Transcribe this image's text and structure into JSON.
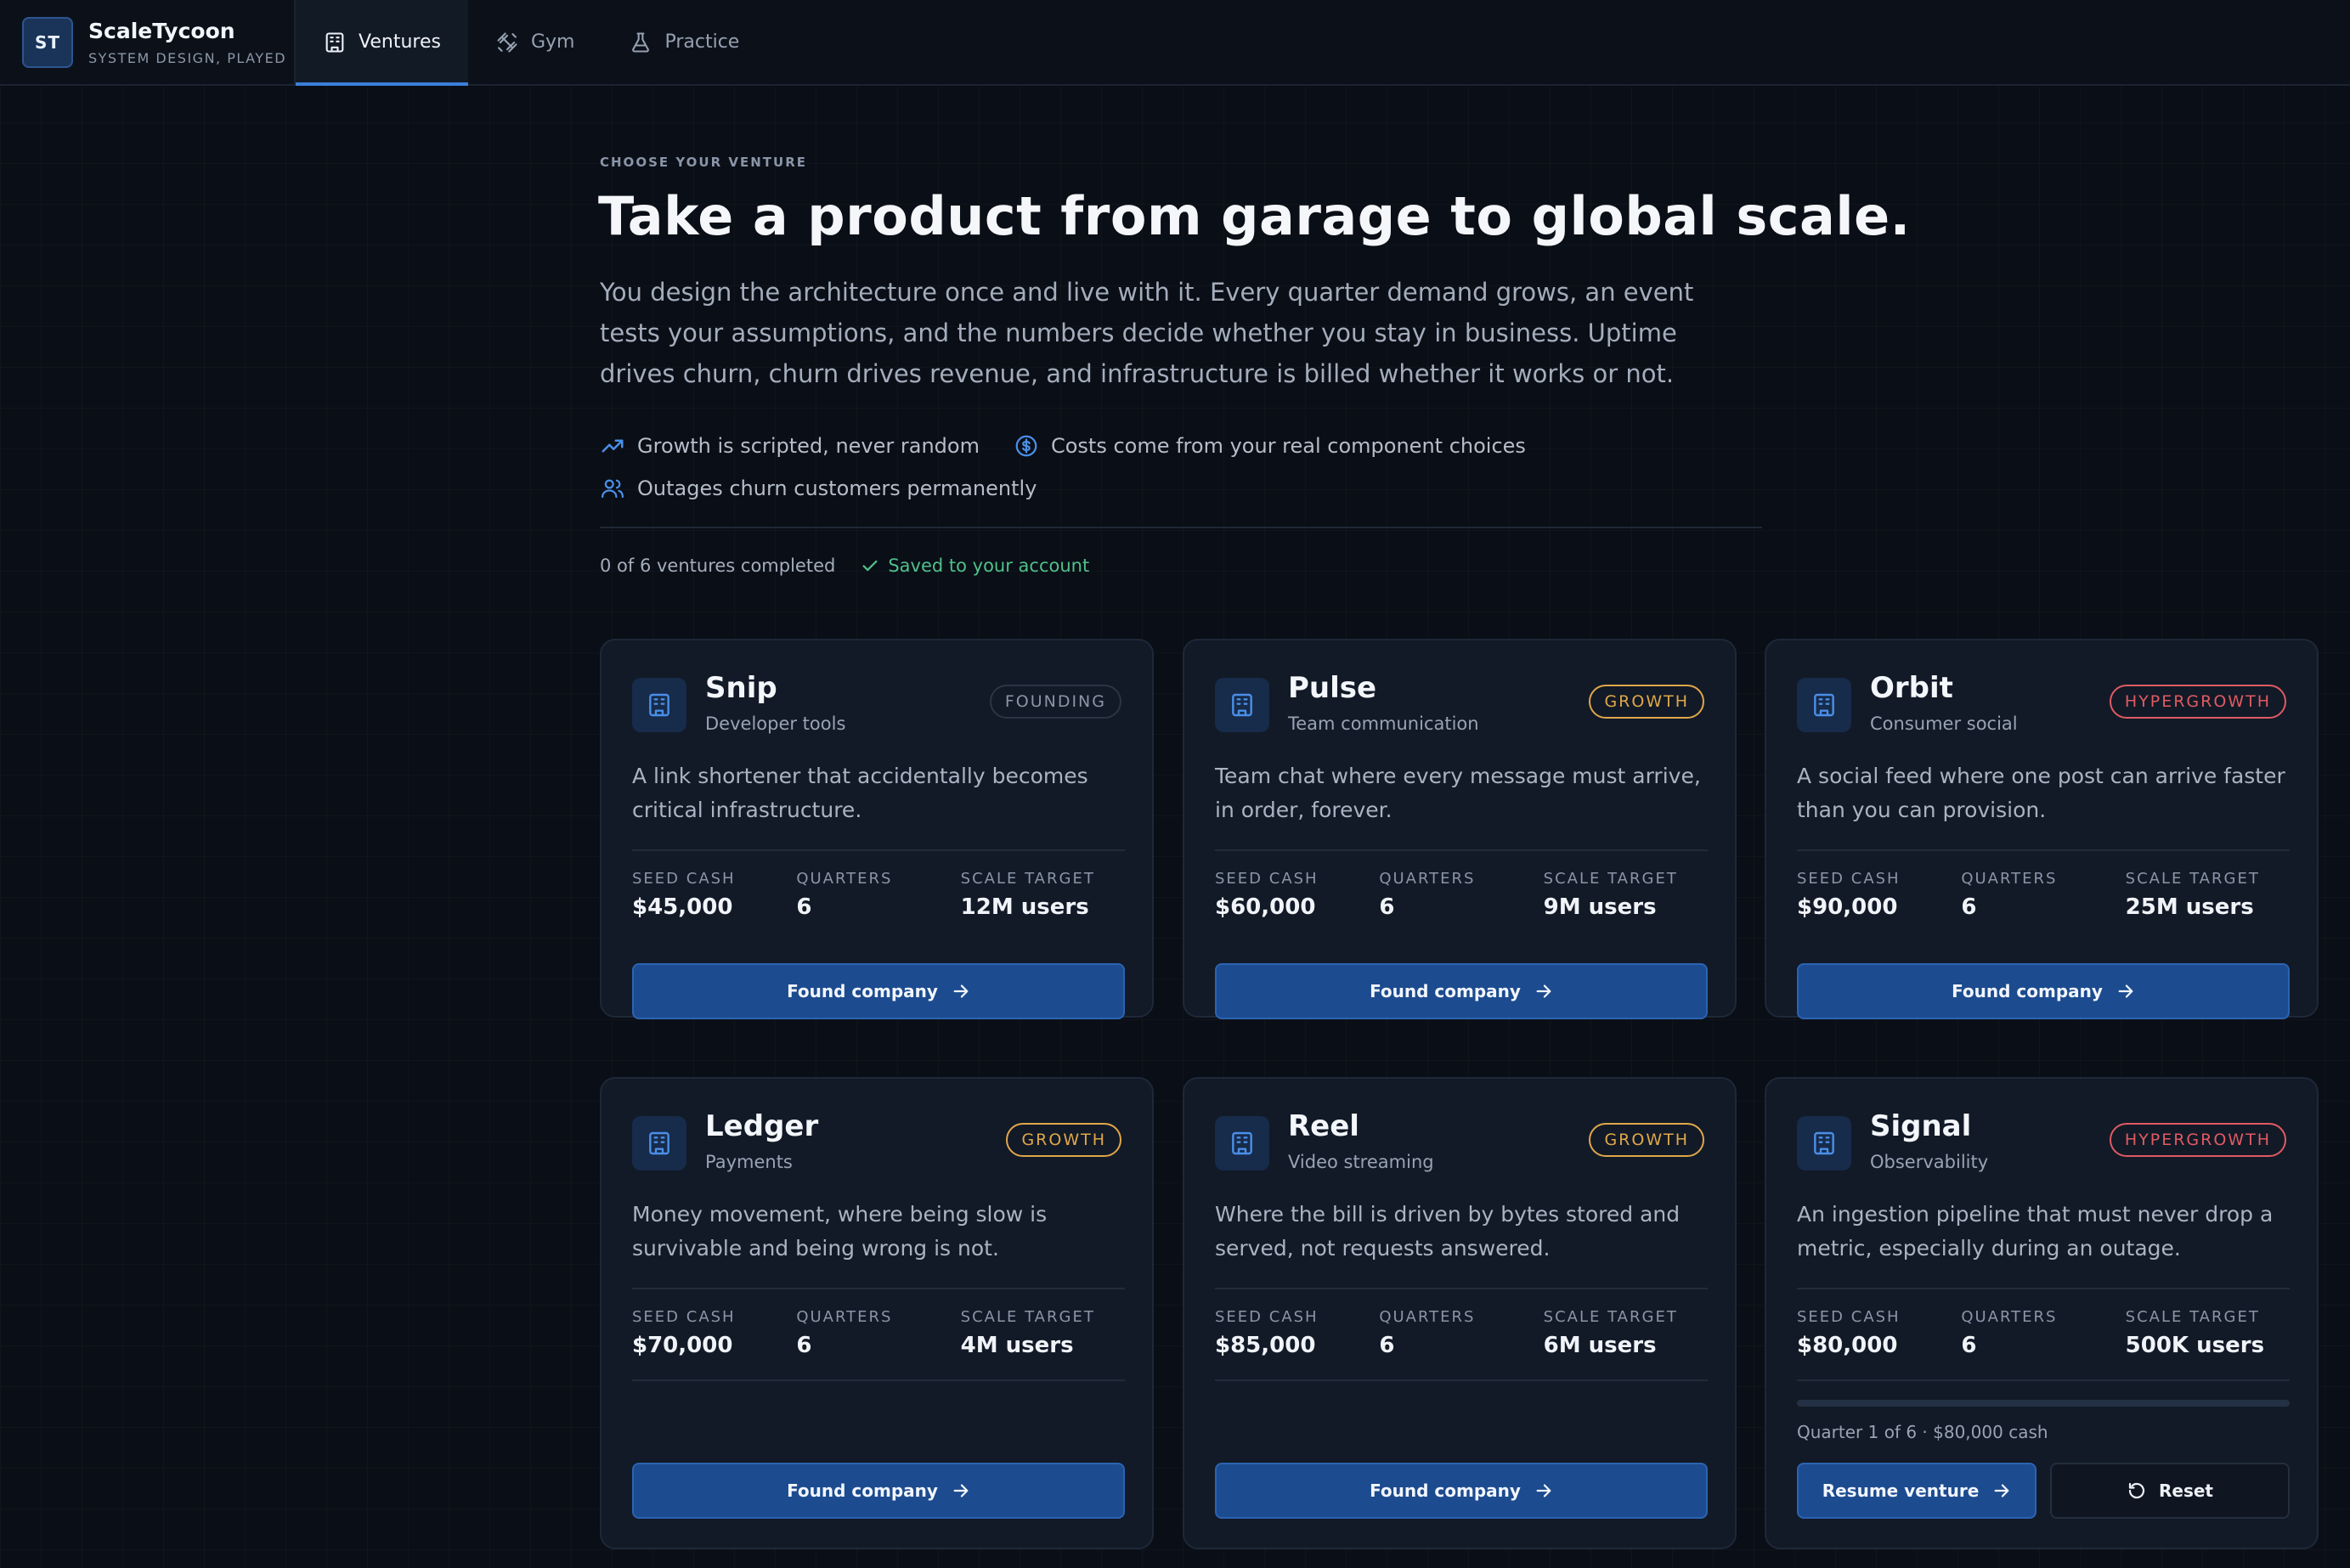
{
  "brand": {
    "logo": "ST",
    "name": "ScaleTycoon",
    "tagline": "SYSTEM DESIGN, PLAYED"
  },
  "nav": {
    "tabs": [
      {
        "label": "Ventures",
        "icon": "building-icon",
        "active": true
      },
      {
        "label": "Gym",
        "icon": "dumbbell-icon",
        "active": false
      },
      {
        "label": "Practice",
        "icon": "flask-icon",
        "active": false
      }
    ]
  },
  "hero": {
    "eyebrow": "CHOOSE YOUR VENTURE",
    "headline": "Take a product from garage to global scale.",
    "intro": "You design the architecture once and live with it. Every quarter demand grows, an event tests your assumptions, and the numbers decide whether you stay in business. Uptime drives churn, churn drives revenue, and infrastructure is billed whether it works or not.",
    "features": [
      {
        "icon": "trending-up-icon",
        "text": "Growth is scripted, never random"
      },
      {
        "icon": "dollar-circle-icon",
        "text": "Costs come from your real component choices"
      },
      {
        "icon": "users-icon",
        "text": "Outages churn customers permanently"
      }
    ]
  },
  "progress": {
    "count": "0 of 6 ventures completed",
    "saved": "Saved to your account"
  },
  "stat_labels": {
    "cash": "SEED CASH",
    "quarters": "QUARTERS",
    "target": "SCALE TARGET"
  },
  "colors": {
    "founding": "#8b95a6",
    "growth": "#e0a74a",
    "hypergrowth": "#e05a63",
    "accent": "#3b7fd9"
  },
  "ventures": [
    {
      "name": "Snip",
      "category": "Developer tools",
      "stage": "FOUNDING",
      "description": "A link shortener that accidentally becomes critical infrastructure.",
      "seed_cash": "$45,000",
      "quarters": "6",
      "scale_target": "12M users",
      "action": "Found company"
    },
    {
      "name": "Pulse",
      "category": "Team communication",
      "stage": "GROWTH",
      "description": "Team chat where every message must arrive, in order, forever.",
      "seed_cash": "$60,000",
      "quarters": "6",
      "scale_target": "9M users",
      "action": "Found company"
    },
    {
      "name": "Orbit",
      "category": "Consumer social",
      "stage": "HYPERGROWTH",
      "description": "A social feed where one post can arrive faster than you can provision.",
      "seed_cash": "$90,000",
      "quarters": "6",
      "scale_target": "25M users",
      "action": "Found company"
    },
    {
      "name": "Ledger",
      "category": "Payments",
      "stage": "GROWTH",
      "description": "Money movement, where being slow is survivable and being wrong is not.",
      "seed_cash": "$70,000",
      "quarters": "6",
      "scale_target": "4M users",
      "action": "Found company"
    },
    {
      "name": "Reel",
      "category": "Video streaming",
      "stage": "GROWTH",
      "description": "Where the bill is driven by bytes stored and served, not requests answered.",
      "seed_cash": "$85,000",
      "quarters": "6",
      "scale_target": "6M users",
      "action": "Found company"
    },
    {
      "name": "Signal",
      "category": "Observability",
      "stage": "HYPERGROWTH",
      "description": "An ingestion pipeline that must never drop a metric, especially during an outage.",
      "seed_cash": "$80,000",
      "quarters": "6",
      "scale_target": "500K users",
      "in_progress": {
        "status": "Quarter 1 of 6 · $80,000 cash",
        "progress": 0,
        "resume_label": "Resume venture",
        "reset_label": "Reset"
      }
    }
  ]
}
